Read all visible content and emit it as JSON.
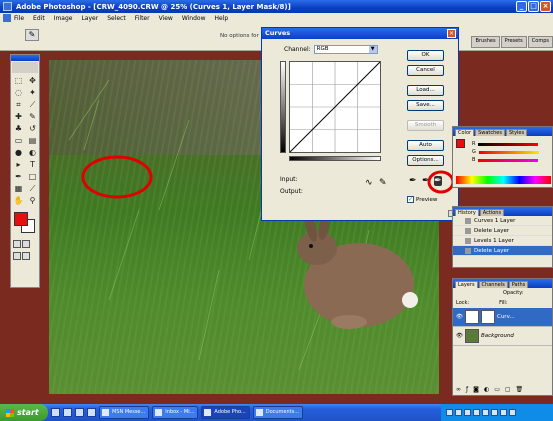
{
  "window": {
    "title": "Adobe Photoshop - [CRW_4090.CRW @ 25% (Curves 1, Layer Mask/8)]"
  },
  "menu": {
    "items": [
      "File",
      "Edit",
      "Image",
      "Layer",
      "Select",
      "Filter",
      "View",
      "Window",
      "Help"
    ]
  },
  "options_bar": {
    "hint": "No options for"
  },
  "palette_well": {
    "tabs": [
      "Brushes",
      "Presets",
      "Comps"
    ]
  },
  "curves": {
    "title": "Curves",
    "channel_label": "Channel:",
    "channel_value": "RGB",
    "input_label": "Input:",
    "output_label": "Output:",
    "buttons": {
      "ok": "OK",
      "cancel": "Cancel",
      "load": "Load...",
      "save": "Save...",
      "smooth": "Smooth",
      "auto": "Auto",
      "options": "Options..."
    },
    "preview_label": "Preview",
    "preview_checked": true
  },
  "color_palette": {
    "tabs": [
      "Color",
      "Swatches",
      "Styles"
    ]
  },
  "history": {
    "tabs": [
      "History",
      "Actions"
    ],
    "items": [
      "Curves 1 Layer",
      "Delete Layer",
      "Levels 1 Layer",
      "Delete Layer"
    ]
  },
  "layers": {
    "tabs": [
      "Layers",
      "Channels",
      "Paths"
    ],
    "opacity_label": "Opacity:",
    "lock_label": "Lock:",
    "fill_label": "Fill:",
    "items": [
      {
        "name": "Curv...",
        "selected": true
      },
      {
        "name": "Background",
        "selected": false
      }
    ]
  },
  "taskbar": {
    "start_label": "start",
    "tasks": [
      "MSN Messe...",
      "Inbox - Mi...",
      "Adobe Pho...",
      "Documents..."
    ]
  },
  "colors": {
    "foreground": "#e41010",
    "background": "#ffffff",
    "annotation": "#e00000"
  }
}
